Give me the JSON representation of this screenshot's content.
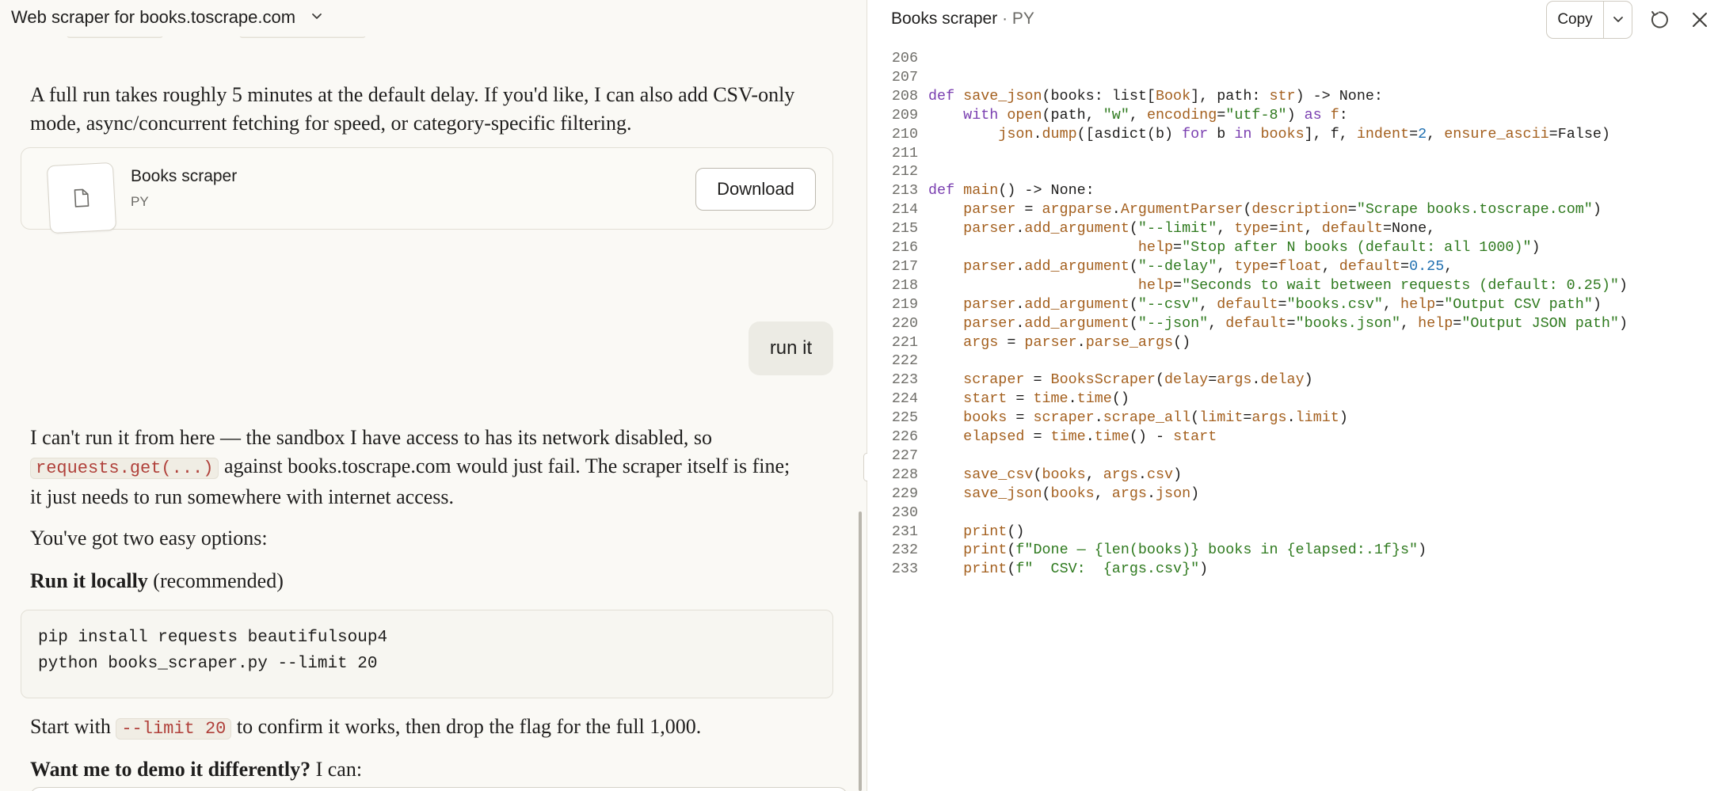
{
  "chat": {
    "title": "Web scraper for books.toscrape.com",
    "para1": "A full run takes roughly 5 minutes at the default delay. If you'd like, I can also add CSV-only mode, async/concurrent fetching for speed, or category-specific filtering.",
    "file_card": {
      "name": "Books scraper",
      "type": "PY",
      "download_label": "Download"
    },
    "user_message": "run it",
    "para2": {
      "part1": "I can't run it from here — the sandbox I have access to has its network disabled, so",
      "code": "requests.get(...)",
      "part2": "against books.toscrape.com would just fail. The scraper itself is fine; it just needs to run somewhere with internet access."
    },
    "para3": "You've got two easy options:",
    "heading_bold": "Run it locally",
    "heading_rest": "(recommended)",
    "code_lines": [
      "pip install requests beautifulsoup4",
      "python books_scraper.py --limit 20"
    ],
    "para4": {
      "part1": "Start with",
      "code": "--limit 20",
      "part2": "to confirm it works, then drop the flag for the full 1,000."
    },
    "para5": {
      "bold": "Want me to demo it differently?",
      "rest": "I can:"
    }
  },
  "artifact": {
    "title": "Books scraper",
    "separator": "·",
    "ext": "PY",
    "copy_label": "Copy",
    "code": [
      {
        "n": "206",
        "t": []
      },
      {
        "n": "207",
        "t": []
      },
      {
        "n": "208",
        "t": [
          [
            "kw",
            "def "
          ],
          [
            "fn",
            "save_json"
          ],
          [
            "p",
            "(books: list["
          ],
          [
            "fn",
            "Book"
          ],
          [
            "p",
            "], path: "
          ],
          [
            "fn",
            "str"
          ],
          [
            "p",
            ") -> None:"
          ]
        ]
      },
      {
        "n": "209",
        "t": [
          [
            "p",
            "    "
          ],
          [
            "kw",
            "with "
          ],
          [
            "fn",
            "open"
          ],
          [
            "p",
            "(path, "
          ],
          [
            "str",
            "\"w\""
          ],
          [
            "p",
            ", "
          ],
          [
            "fn",
            "encoding"
          ],
          [
            "p",
            "="
          ],
          [
            "str",
            "\"utf-8\""
          ],
          [
            "p",
            ") "
          ],
          [
            "kw",
            "as "
          ],
          [
            "fn",
            "f"
          ],
          [
            "p",
            ":"
          ]
        ]
      },
      {
        "n": "210",
        "t": [
          [
            "p",
            "        "
          ],
          [
            "fn",
            "json"
          ],
          [
            "p",
            "."
          ],
          [
            "fn",
            "dump"
          ],
          [
            "p",
            "([asdict(b) "
          ],
          [
            "kw",
            "for "
          ],
          [
            "p",
            "b "
          ],
          [
            "kw",
            "in "
          ],
          [
            "fn",
            "books"
          ],
          [
            "p",
            "], f, "
          ],
          [
            "fn",
            "indent"
          ],
          [
            "p",
            "="
          ],
          [
            "num",
            "2"
          ],
          [
            "p",
            ", "
          ],
          [
            "fn",
            "ensure_ascii"
          ],
          [
            "p",
            "=False)"
          ]
        ]
      },
      {
        "n": "211",
        "t": []
      },
      {
        "n": "212",
        "t": []
      },
      {
        "n": "213",
        "t": [
          [
            "kw",
            "def "
          ],
          [
            "fn",
            "main"
          ],
          [
            "p",
            "() -> None:"
          ]
        ]
      },
      {
        "n": "214",
        "t": [
          [
            "p",
            "    "
          ],
          [
            "fn",
            "parser"
          ],
          [
            "p",
            " = "
          ],
          [
            "fn",
            "argparse"
          ],
          [
            "p",
            "."
          ],
          [
            "fn",
            "ArgumentParser"
          ],
          [
            "p",
            "("
          ],
          [
            "fn",
            "description"
          ],
          [
            "p",
            "="
          ],
          [
            "str",
            "\"Scrape books.toscrape.com\""
          ],
          [
            "p",
            ")"
          ]
        ]
      },
      {
        "n": "215",
        "t": [
          [
            "p",
            "    "
          ],
          [
            "fn",
            "parser"
          ],
          [
            "p",
            "."
          ],
          [
            "fn",
            "add_argument"
          ],
          [
            "p",
            "("
          ],
          [
            "str",
            "\"--limit\""
          ],
          [
            "p",
            ", "
          ],
          [
            "fn",
            "type"
          ],
          [
            "p",
            "="
          ],
          [
            "fn",
            "int"
          ],
          [
            "p",
            ", "
          ],
          [
            "fn",
            "default"
          ],
          [
            "p",
            "=None,"
          ]
        ]
      },
      {
        "n": "216",
        "t": [
          [
            "p",
            "                        "
          ],
          [
            "fn",
            "help"
          ],
          [
            "p",
            "="
          ],
          [
            "str",
            "\"Stop after N books (default: all 1000)\""
          ],
          [
            "p",
            ")"
          ]
        ]
      },
      {
        "n": "217",
        "t": [
          [
            "p",
            "    "
          ],
          [
            "fn",
            "parser"
          ],
          [
            "p",
            "."
          ],
          [
            "fn",
            "add_argument"
          ],
          [
            "p",
            "("
          ],
          [
            "str",
            "\"--delay\""
          ],
          [
            "p",
            ", "
          ],
          [
            "fn",
            "type"
          ],
          [
            "p",
            "="
          ],
          [
            "fn",
            "float"
          ],
          [
            "p",
            ", "
          ],
          [
            "fn",
            "default"
          ],
          [
            "p",
            "="
          ],
          [
            "num",
            "0.25"
          ],
          [
            "p",
            ","
          ]
        ]
      },
      {
        "n": "218",
        "t": [
          [
            "p",
            "                        "
          ],
          [
            "fn",
            "help"
          ],
          [
            "p",
            "="
          ],
          [
            "str",
            "\"Seconds to wait between requests (default: 0.25)\""
          ],
          [
            "p",
            ")"
          ]
        ]
      },
      {
        "n": "219",
        "t": [
          [
            "p",
            "    "
          ],
          [
            "fn",
            "parser"
          ],
          [
            "p",
            "."
          ],
          [
            "fn",
            "add_argument"
          ],
          [
            "p",
            "("
          ],
          [
            "str",
            "\"--csv\""
          ],
          [
            "p",
            ", "
          ],
          [
            "fn",
            "default"
          ],
          [
            "p",
            "="
          ],
          [
            "str",
            "\"books.csv\""
          ],
          [
            "p",
            ", "
          ],
          [
            "fn",
            "help"
          ],
          [
            "p",
            "="
          ],
          [
            "str",
            "\"Output CSV path\""
          ],
          [
            "p",
            ")"
          ]
        ]
      },
      {
        "n": "220",
        "t": [
          [
            "p",
            "    "
          ],
          [
            "fn",
            "parser"
          ],
          [
            "p",
            "."
          ],
          [
            "fn",
            "add_argument"
          ],
          [
            "p",
            "("
          ],
          [
            "str",
            "\"--json\""
          ],
          [
            "p",
            ", "
          ],
          [
            "fn",
            "default"
          ],
          [
            "p",
            "="
          ],
          [
            "str",
            "\"books.json\""
          ],
          [
            "p",
            ", "
          ],
          [
            "fn",
            "help"
          ],
          [
            "p",
            "="
          ],
          [
            "str",
            "\"Output JSON path\""
          ],
          [
            "p",
            ")"
          ]
        ]
      },
      {
        "n": "221",
        "t": [
          [
            "p",
            "    "
          ],
          [
            "fn",
            "args"
          ],
          [
            "p",
            " = "
          ],
          [
            "fn",
            "parser"
          ],
          [
            "p",
            "."
          ],
          [
            "fn",
            "parse_args"
          ],
          [
            "p",
            "()"
          ]
        ]
      },
      {
        "n": "222",
        "t": []
      },
      {
        "n": "223",
        "t": [
          [
            "p",
            "    "
          ],
          [
            "fn",
            "scraper"
          ],
          [
            "p",
            " = "
          ],
          [
            "fn",
            "BooksScraper"
          ],
          [
            "p",
            "("
          ],
          [
            "fn",
            "delay"
          ],
          [
            "p",
            "="
          ],
          [
            "fn",
            "args"
          ],
          [
            "p",
            "."
          ],
          [
            "fn",
            "delay"
          ],
          [
            "p",
            ")"
          ]
        ]
      },
      {
        "n": "224",
        "t": [
          [
            "p",
            "    "
          ],
          [
            "fn",
            "start"
          ],
          [
            "p",
            " = "
          ],
          [
            "fn",
            "time"
          ],
          [
            "p",
            "."
          ],
          [
            "fn",
            "time"
          ],
          [
            "p",
            "()"
          ]
        ]
      },
      {
        "n": "225",
        "t": [
          [
            "p",
            "    "
          ],
          [
            "fn",
            "books"
          ],
          [
            "p",
            " = "
          ],
          [
            "fn",
            "scraper"
          ],
          [
            "p",
            "."
          ],
          [
            "fn",
            "scrape_all"
          ],
          [
            "p",
            "("
          ],
          [
            "fn",
            "limit"
          ],
          [
            "p",
            "="
          ],
          [
            "fn",
            "args"
          ],
          [
            "p",
            "."
          ],
          [
            "fn",
            "limit"
          ],
          [
            "p",
            ")"
          ]
        ]
      },
      {
        "n": "226",
        "t": [
          [
            "p",
            "    "
          ],
          [
            "fn",
            "elapsed"
          ],
          [
            "p",
            " = "
          ],
          [
            "fn",
            "time"
          ],
          [
            "p",
            "."
          ],
          [
            "fn",
            "time"
          ],
          [
            "p",
            "() - "
          ],
          [
            "fn",
            "start"
          ]
        ]
      },
      {
        "n": "227",
        "t": []
      },
      {
        "n": "228",
        "t": [
          [
            "p",
            "    "
          ],
          [
            "fn",
            "save_csv"
          ],
          [
            "p",
            "("
          ],
          [
            "fn",
            "books"
          ],
          [
            "p",
            ", "
          ],
          [
            "fn",
            "args"
          ],
          [
            "p",
            "."
          ],
          [
            "fn",
            "csv"
          ],
          [
            "p",
            ")"
          ]
        ]
      },
      {
        "n": "229",
        "t": [
          [
            "p",
            "    "
          ],
          [
            "fn",
            "save_json"
          ],
          [
            "p",
            "("
          ],
          [
            "fn",
            "books"
          ],
          [
            "p",
            ", "
          ],
          [
            "fn",
            "args"
          ],
          [
            "p",
            "."
          ],
          [
            "fn",
            "json"
          ],
          [
            "p",
            ")"
          ]
        ]
      },
      {
        "n": "230",
        "t": []
      },
      {
        "n": "231",
        "t": [
          [
            "p",
            "    "
          ],
          [
            "fn",
            "print"
          ],
          [
            "p",
            "()"
          ]
        ]
      },
      {
        "n": "232",
        "t": [
          [
            "p",
            "    "
          ],
          [
            "fn",
            "print"
          ],
          [
            "p",
            "("
          ],
          [
            "str",
            "f\"Done — {len(books)} books in {elapsed:.1f}s\""
          ],
          [
            "p",
            ")"
          ]
        ]
      },
      {
        "n": "233",
        "t": [
          [
            "p",
            "    "
          ],
          [
            "fn",
            "print"
          ],
          [
            "p",
            "("
          ],
          [
            "str",
            "f\"  CSV:  {args.csv}\""
          ],
          [
            "p",
            ")"
          ]
        ]
      }
    ]
  }
}
